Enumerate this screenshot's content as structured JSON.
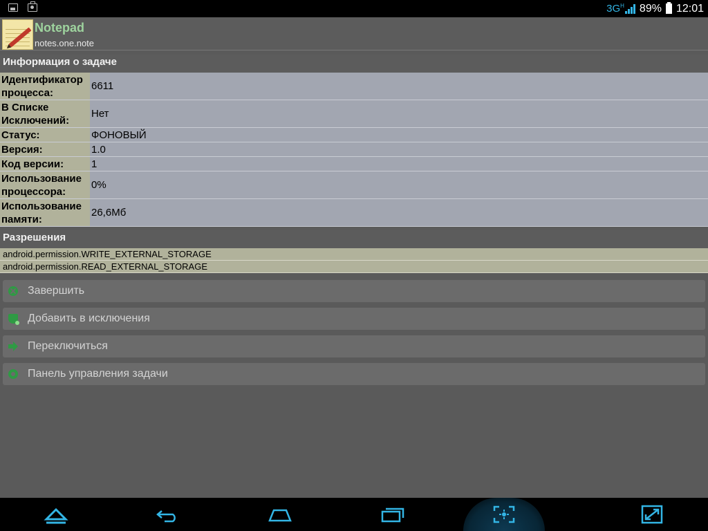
{
  "status_bar": {
    "network": "3G",
    "network_sup": "H",
    "battery": "89%",
    "time": "12:01",
    "left_icons": [
      "image-icon",
      "bag-icon"
    ]
  },
  "app": {
    "name": "Notepad",
    "package": "notes.one.note"
  },
  "info_section": {
    "title": "Информация о задаче",
    "rows": [
      {
        "label": "Идентификатор процесса:",
        "value": "6611"
      },
      {
        "label": "В Списке Исключений:",
        "value": "Нет"
      },
      {
        "label": "Статус:",
        "value": "ФОНОВЫЙ"
      },
      {
        "label": "Версия:",
        "value": "1.0"
      },
      {
        "label": "Код версии:",
        "value": "1"
      },
      {
        "label": "Использование процессора:",
        "value": "0%"
      },
      {
        "label": "Использование памяти:",
        "value": "26,6Мб"
      }
    ]
  },
  "permissions_section": {
    "title": "Разрешения",
    "items": [
      "android.permission.WRITE_EXTERNAL_STORAGE",
      "android.permission.READ_EXTERNAL_STORAGE"
    ]
  },
  "actions": [
    {
      "label": "Завершить",
      "icon": "close-circle-icon"
    },
    {
      "label": "Добавить в исключения",
      "icon": "shield-icon"
    },
    {
      "label": "Переключиться",
      "icon": "arrow-right-icon"
    },
    {
      "label": "Панель управления задачи",
      "icon": "gear-icon"
    }
  ],
  "nav_bar": {
    "buttons": [
      "hide-bar-icon",
      "back-icon",
      "home-icon",
      "recents-icon",
      "screenshot-icon",
      "fullscreen-icon"
    ],
    "accent": "#33b5e5"
  }
}
